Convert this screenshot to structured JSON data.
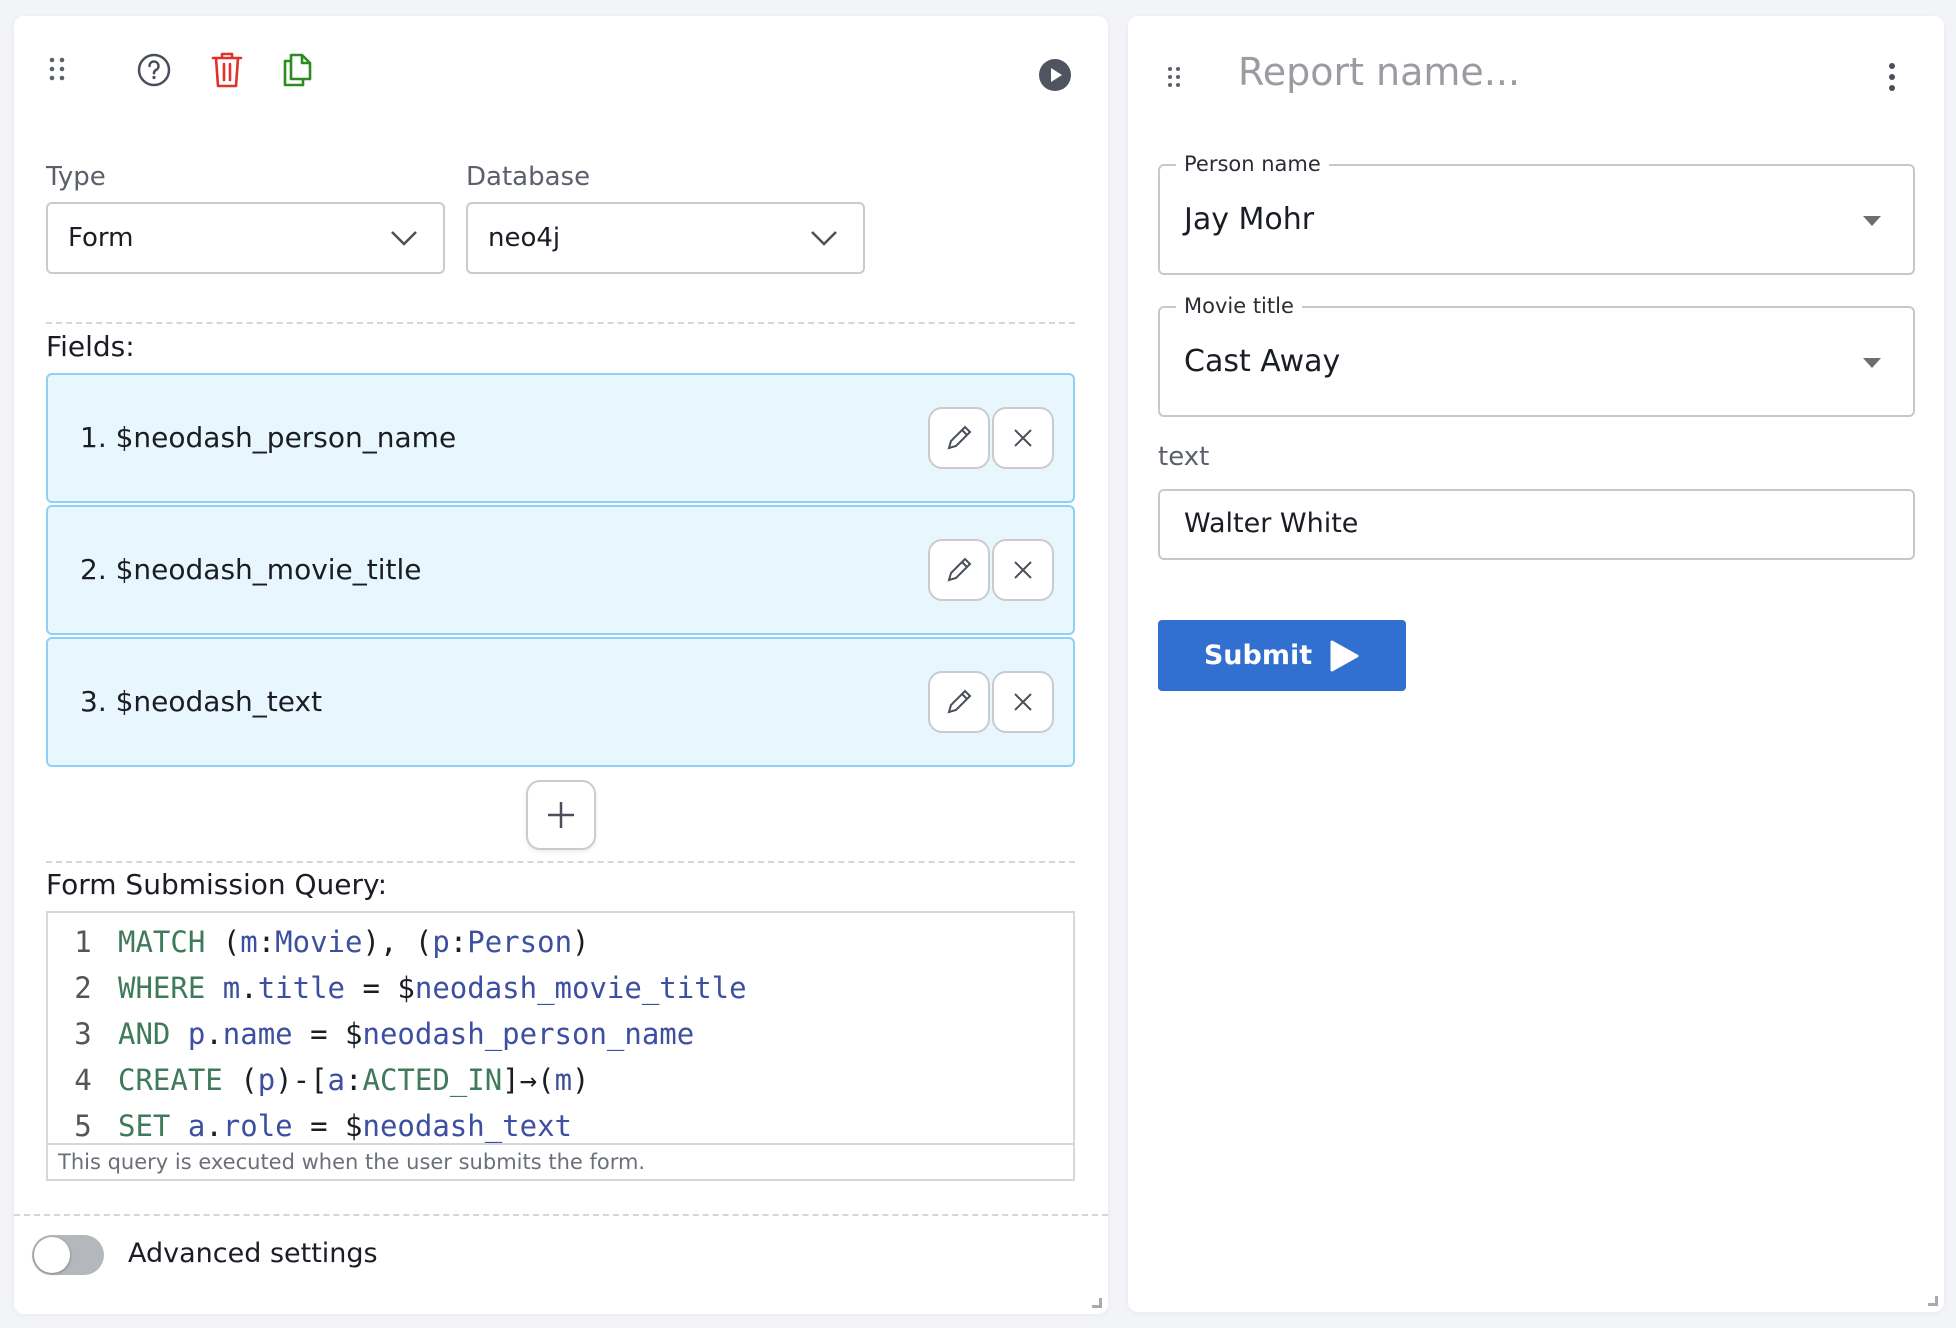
{
  "left_panel": {
    "header": {
      "drag_handle_icon": "drag-dots-icon",
      "help_icon": "help-circle-icon",
      "delete_icon": "trash-icon",
      "copy_icon": "copy-icon",
      "run_icon": "play-circle-icon"
    },
    "type": {
      "label": "Type",
      "value": "Form"
    },
    "database": {
      "label": "Database",
      "value": "neo4j"
    },
    "fields_label": "Fields:",
    "fields": [
      {
        "text": "1. $neodash_person_name"
      },
      {
        "text": "2. $neodash_movie_title"
      },
      {
        "text": "3. $neodash_text"
      }
    ],
    "query_label": "Form Submission Query:",
    "query_lines": [
      {
        "n": "1",
        "tokens": [
          [
            "kw",
            "MATCH"
          ],
          [
            "op",
            " ("
          ],
          [
            "vr",
            "m"
          ],
          [
            "op",
            ":"
          ],
          [
            "vr",
            "Movie"
          ],
          [
            "op",
            "), ("
          ],
          [
            "vr",
            "p"
          ],
          [
            "op",
            ":"
          ],
          [
            "vr",
            "Person"
          ],
          [
            "op",
            ")"
          ]
        ]
      },
      {
        "n": "2",
        "tokens": [
          [
            "kw",
            "WHERE"
          ],
          [
            "op",
            " "
          ],
          [
            "vr",
            "m"
          ],
          [
            "op",
            "."
          ],
          [
            "vr",
            "title"
          ],
          [
            "op",
            " = $"
          ],
          [
            "vr",
            "neodash_movie_title"
          ]
        ]
      },
      {
        "n": "3",
        "tokens": [
          [
            "kw",
            "AND"
          ],
          [
            "op",
            " "
          ],
          [
            "vr",
            "p"
          ],
          [
            "op",
            "."
          ],
          [
            "vr",
            "name"
          ],
          [
            "op",
            " = $"
          ],
          [
            "vr",
            "neodash_person_name"
          ]
        ]
      },
      {
        "n": "4",
        "tokens": [
          [
            "kw",
            "CREATE"
          ],
          [
            "op",
            " ("
          ],
          [
            "vr",
            "p"
          ],
          [
            "op",
            ")-["
          ],
          [
            "vr",
            "a"
          ],
          [
            "op",
            ":"
          ],
          [
            "kw",
            "ACTED_IN"
          ],
          [
            "op",
            "]→("
          ],
          [
            "vr",
            "m"
          ],
          [
            "op",
            ")"
          ]
        ]
      },
      {
        "n": "5",
        "tokens": [
          [
            "kw",
            "SET"
          ],
          [
            "op",
            " "
          ],
          [
            "vr",
            "a"
          ],
          [
            "op",
            "."
          ],
          [
            "vr",
            "role"
          ],
          [
            "op",
            " = $"
          ],
          [
            "vr",
            "neodash_text"
          ]
        ]
      }
    ],
    "query_hint": "This query is executed when the user submits the form.",
    "advanced_settings": {
      "label": "Advanced settings",
      "enabled": false
    }
  },
  "right_panel": {
    "title_placeholder": "Report name...",
    "person_name": {
      "label": "Person name",
      "value": "Jay Mohr"
    },
    "movie_title": {
      "label": "Movie title",
      "value": "Cast Away"
    },
    "text_field": {
      "label": "text",
      "value": "Walter White"
    },
    "submit_label": "Submit"
  },
  "colors": {
    "delete": "#e0312a",
    "copy": "#2e8b22",
    "accent": "#316fd0",
    "field_bg": "#e8f6fd",
    "field_border": "#8fd0f5",
    "code_keyword": "#3f7a5a",
    "code_variable": "#3c4fa0"
  }
}
